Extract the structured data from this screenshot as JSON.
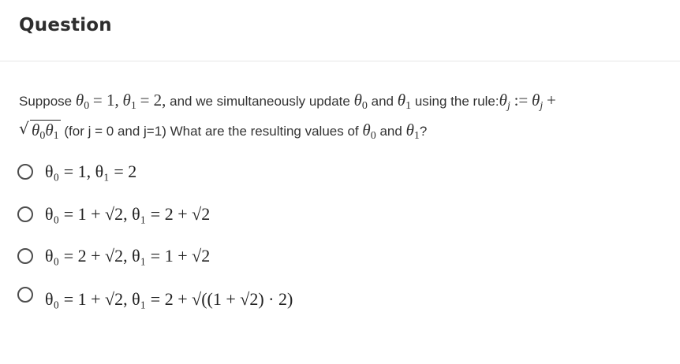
{
  "header": {
    "title": "Question"
  },
  "question": {
    "intro": "Suppose",
    "theta0_eq": "= 1,",
    "theta1_eq": "= 2,",
    "mid": "and we simultaneously update",
    "and": "and",
    "rule": "using the rule:",
    "rule_assign": ":=",
    "rule_plus": "+",
    "note": "(for j = 0 and j=1) What are the resulting values of",
    "end": "?"
  },
  "options": [
    {
      "label": "θ₀ = 1, θ₁ = 2",
      "selected": false
    },
    {
      "label": "θ₀ = 1 + √2, θ₁ = 2 + √2",
      "selected": false
    },
    {
      "label": "θ₀ = 2 + √2, θ₁ = 1 + √2",
      "selected": false
    },
    {
      "label": "θ₀ = 1 + √2, θ₁ = 2 + √((1 + √2) · 2)",
      "selected": false
    }
  ]
}
